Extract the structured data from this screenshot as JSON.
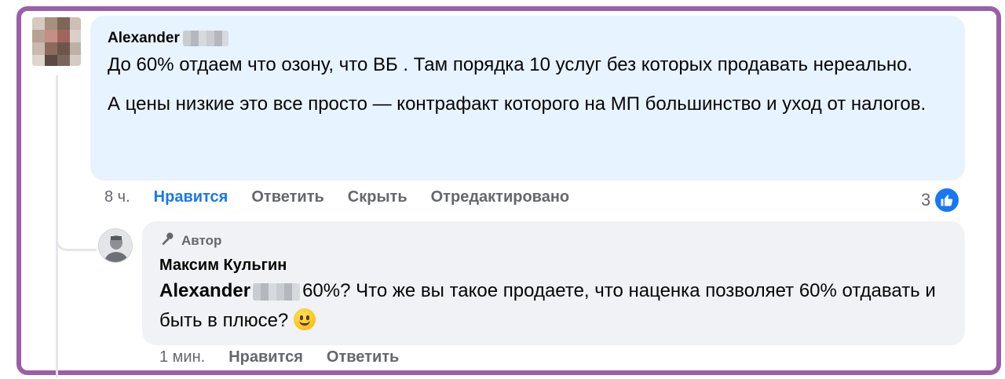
{
  "comment": {
    "author": "Alexander",
    "paragraphs": [
      "До 60% отдаем что озону, что ВБ . Там порядка 10 услуг без которых продавать нереально.",
      "А цены низкие это все просто — контрафакт которого на МП большинство и уход от налогов."
    ],
    "time": "8 ч.",
    "actions": {
      "like": "Нравится",
      "reply": "Ответить",
      "hide": "Скрыть",
      "edited": "Отредактировано"
    },
    "reaction_count": "3",
    "reaction_icon": "thumbs-up-icon"
  },
  "reply": {
    "badge": "Автор",
    "badge_icon": "microphone-icon",
    "author": "Максим Кульгин",
    "mention": "Alexander",
    "text": "60%? Что же вы такое продаете, что наценка позволяет 60% отдавать и быть в плюсе?",
    "emoji": "smiling-face-icon",
    "time": "1 мин.",
    "actions": {
      "like": "Нравится",
      "reply": "Ответить"
    }
  },
  "colors": {
    "frame": "#9b5fa6",
    "main_bubble": "#e7f3ff",
    "reply_bubble": "#f0f2f5",
    "accent": "#1877f2",
    "muted": "#65676b"
  }
}
